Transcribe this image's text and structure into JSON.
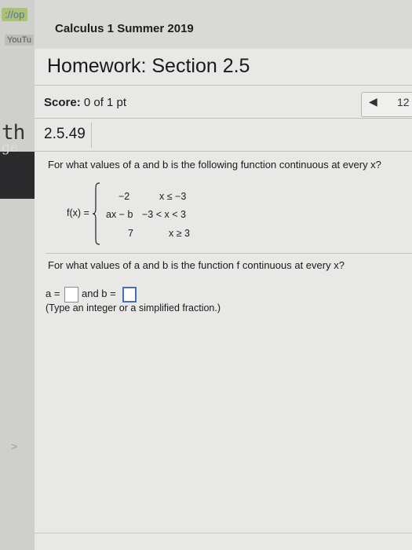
{
  "sidebar": {
    "url_fragment": "://op",
    "youtube_label": "YouTu",
    "subject_fragment": "th",
    "section_fragment": "ge",
    "collapse_arrow": ">"
  },
  "header": {
    "course_title": "Calculus 1 Summer 2019",
    "homework_title": "Homework: Section 2.5"
  },
  "score": {
    "label": "Score:",
    "value": "0 of 1 pt"
  },
  "navigation": {
    "prev_arrow": "◀",
    "question_number": "12"
  },
  "question": {
    "id": "2.5.49",
    "prompt": "For what values of a and b is the following function continuous at every x?",
    "function_label": "f(x) =",
    "pieces": [
      {
        "value": "−2",
        "condition": "x ≤ −3"
      },
      {
        "value": "ax − b",
        "condition": "−3 < x < 3"
      },
      {
        "value": "7",
        "condition": "x ≥ 3"
      }
    ],
    "followup": "For what values of a and b is the function f continuous at every x?",
    "answer_a_label": "a =",
    "answer_and_b_label": "and b =",
    "answer_a_value": "",
    "answer_b_value": "",
    "hint": "(Type an integer or a simplified fraction.)"
  },
  "colors": {
    "page_bg": "#e8e8e6",
    "active_input_border": "#4a6cb5"
  }
}
